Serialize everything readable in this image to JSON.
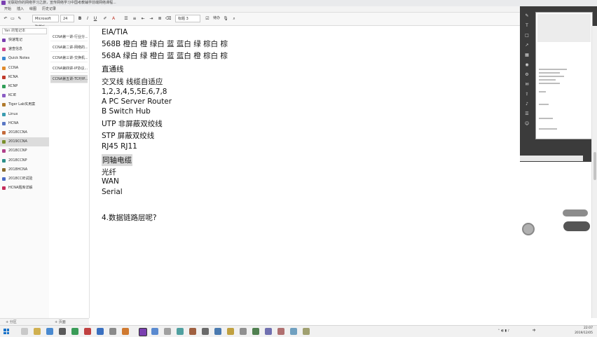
{
  "window": {
    "title": "论联助你的网络学习之旅，宣传网络学习中国考教辅学前端网络课程..."
  },
  "ribbon_tabs": [
    "开始",
    "插入",
    "绘图",
    "历史记录"
  ],
  "toolbar": {
    "font_name": "Microsoft YaHei",
    "font_size": "24",
    "bold": "B",
    "italic": "I",
    "underline": "U",
    "style_name": "标题 3",
    "check_label": "待办"
  },
  "sidebar": {
    "search_placeholder": "Yan 的笔记本",
    "items": [
      {
        "label": "快速笔记",
        "color": "#7a3fb0"
      },
      {
        "label": "速查信息",
        "color": "#d04a8a"
      },
      {
        "label": "Quick Notes",
        "color": "#3a87d0"
      },
      {
        "label": "CCNA",
        "color": "#e08a2c"
      },
      {
        "label": "KCNA",
        "color": "#c0392b"
      },
      {
        "label": "KCNP",
        "color": "#2f9e58"
      },
      {
        "label": "KCIE",
        "color": "#8a5cc4"
      },
      {
        "label": "Tiger Lab实用案",
        "color": "#b07a2c"
      },
      {
        "label": "Linux",
        "color": "#3a9cb0"
      },
      {
        "label": "HCNA",
        "color": "#5a77c4"
      },
      {
        "label": "2018CCNA",
        "color": "#c46a3a"
      },
      {
        "label": "2019CCNA",
        "color": "#7a8f2c"
      },
      {
        "label": "2018CCNP",
        "color": "#b0408a"
      },
      {
        "label": "2018CCNP",
        "color": "#2c8f8a"
      },
      {
        "label": "2018HCNA",
        "color": "#8a6a2c"
      },
      {
        "label": "2018CCIE试验",
        "color": "#4a6ac4"
      },
      {
        "label": "HCNA题库详解",
        "color": "#c42c5a"
      }
    ],
    "footer_add": "+ 分区"
  },
  "sections": {
    "items": [
      {
        "label": "CCNA第一讲-行业分..."
      },
      {
        "label": "CCNA第二讲-网络的..."
      },
      {
        "label": "CCNA第三讲-交换机..."
      },
      {
        "label": "CCNA第四讲-IP协议..."
      },
      {
        "label": "CCNA第五讲-TCP/IP..."
      }
    ],
    "footer_add": "+ 页面"
  },
  "content": {
    "lines": [
      "EIA/TIA",
      "568B  橙白 橙 绿白 蓝 蓝白 绿 棕白 棕",
      "568A  绿白 绿 橙白 蓝 蓝白 橙 棕白 棕",
      "直通线",
      "交叉线   线缆自适应",
      "1,2,3,4,5,5E,6,7,8",
      "A PC Server Router",
      "B Switch Hub",
      "UTP  非屏蔽双绞线",
      "STP   屏蔽双绞线",
      "RJ45    RJ11",
      "同轴电缆",
      "光纤",
      "WAN",
      "Serial",
      "4.数据链路层呢?"
    ]
  },
  "taskbar": {
    "lang": "中",
    "time": "22:07",
    "date": "2019/12/05"
  },
  "colors": {
    "accent": "#7a3fb0",
    "highlight": "#d9d9d9"
  }
}
